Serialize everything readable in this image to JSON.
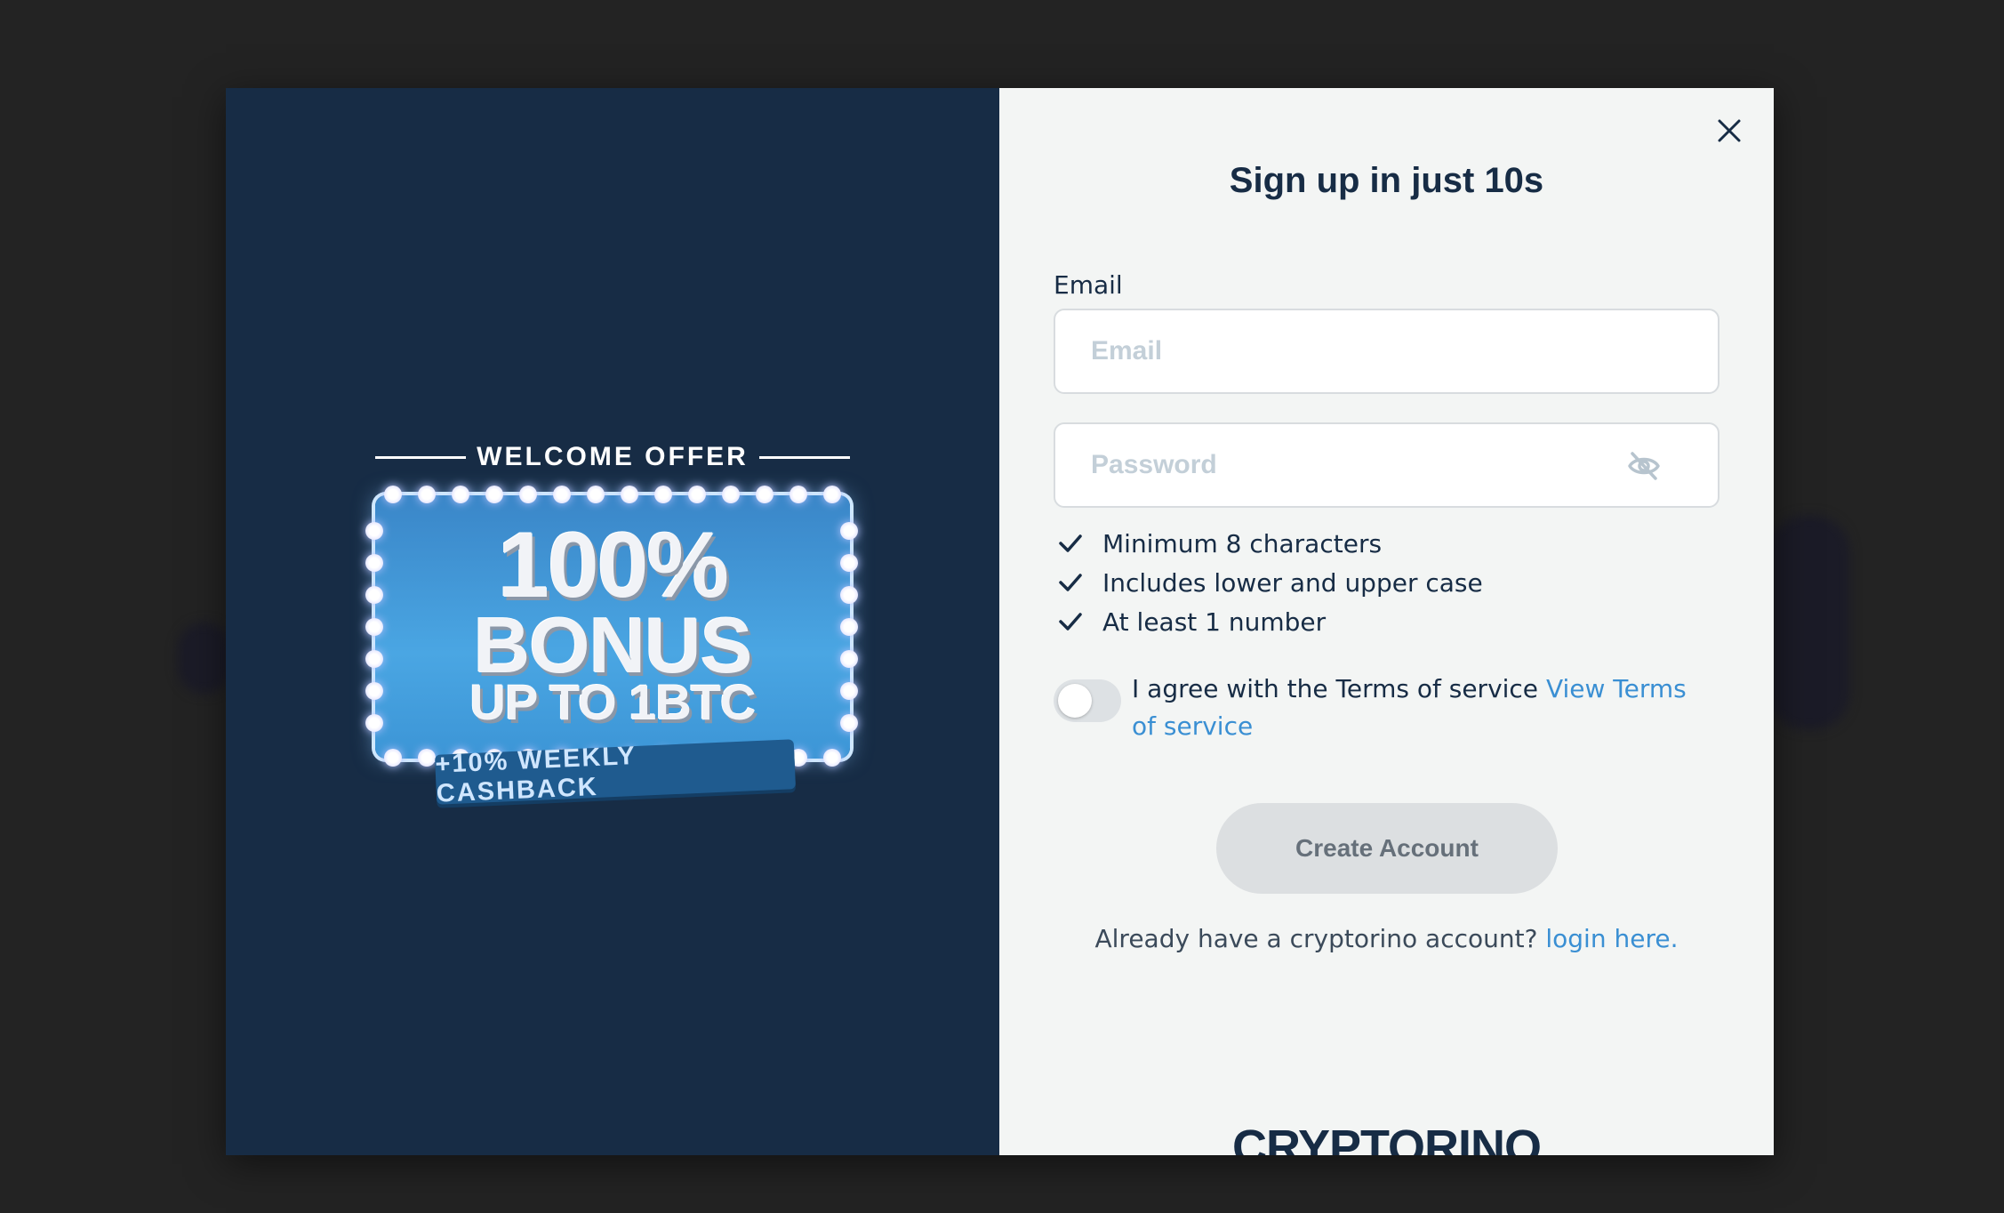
{
  "promo": {
    "heading": "WELCOME OFFER",
    "bonus_line1": "100%",
    "bonus_line2": "BONUS",
    "bonus_line3": "UP TO 1BTC",
    "cashback": "+10% WEEKLY CASHBACK"
  },
  "form": {
    "title": "Sign up in just 10s",
    "email_label": "Email",
    "email_placeholder": "Email",
    "password_placeholder": "Password",
    "rules": [
      "Minimum 8 characters",
      "Includes lower and upper case",
      "At least 1 number"
    ],
    "terms_text": "I agree with the Terms of service",
    "terms_link": "View Terms of service",
    "terms_agreed": false,
    "create_button": "Create Account",
    "login_prompt": "Already have a cryptorino account?",
    "login_link": "login here.",
    "brand": "CRYPTORINO"
  },
  "colors": {
    "promo_bg": "#172c45",
    "form_bg": "#f3f5f4",
    "accent_link": "#3a8fd3",
    "text_dark": "#172c45"
  },
  "icons": {
    "close": "close-icon",
    "password_toggle": "eye-off-icon",
    "rule_check": "check-icon"
  }
}
